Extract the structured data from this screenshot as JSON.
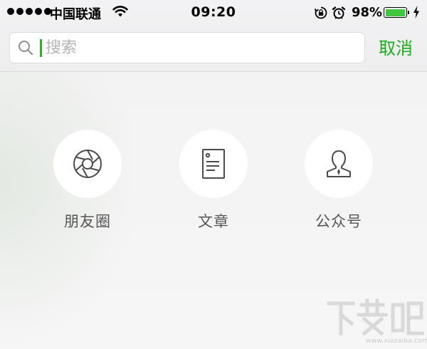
{
  "status_bar": {
    "carrier": "中国联通",
    "time": "09:20",
    "battery_percent": "98%",
    "battery_level": 0.98,
    "battery_color": "#3fc83f"
  },
  "search": {
    "placeholder": "搜索",
    "value": "",
    "cancel_label": "取消",
    "accent_color": "#1aad19"
  },
  "categories": [
    {
      "label": "朋友圈",
      "icon": "camera-aperture-icon"
    },
    {
      "label": "文章",
      "icon": "document-icon"
    },
    {
      "label": "公众号",
      "icon": "person-bust-icon"
    }
  ],
  "watermark": {
    "text": "www.xiazaiba.com",
    "logo": "xiazaiba-logo"
  }
}
